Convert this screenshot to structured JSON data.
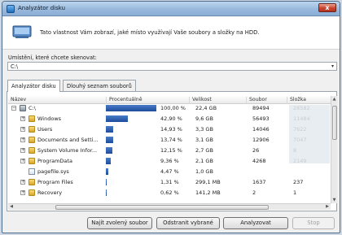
{
  "window": {
    "title": "Analyzátor disku",
    "close_label": "x"
  },
  "info": {
    "description": "Tato vlastnost Vám zobrazí, jaké místo využívají Vaše soubory a složky na HDD."
  },
  "path": {
    "label": "Umístění, které chcete skenovat:",
    "value": "C:\\"
  },
  "tabs": [
    {
      "label": "Analyzátor disku"
    },
    {
      "label": "Dlouhý seznam souborů"
    }
  ],
  "columns": {
    "name": "Název",
    "percent": "Procentuálně",
    "size": "Velikost",
    "files": "Soubor",
    "folders": "Složka"
  },
  "rows": [
    {
      "name": "C:\\",
      "icon": "drive-icon",
      "expander": "−",
      "percent_label": "100,00 %",
      "percent": 100,
      "size": "22,4 GB",
      "files": "89494",
      "folders": "28582"
    },
    {
      "name": "Windows",
      "icon": "folder-icon",
      "expander": "+",
      "percent_label": "42,90 %",
      "percent": 42.9,
      "size": "9,6 GB",
      "files": "56493",
      "folders": "11484"
    },
    {
      "name": "Users",
      "icon": "folder-icon",
      "expander": "+",
      "percent_label": "14,93 %",
      "percent": 14.93,
      "size": "3,3 GB",
      "files": "14046",
      "folders": "7622"
    },
    {
      "name": "Documents and Setti...",
      "icon": "folder-icon",
      "expander": "+",
      "percent_label": "13,74 %",
      "percent": 13.74,
      "size": "3,1 GB",
      "files": "12906",
      "folders": "7047"
    },
    {
      "name": "System Volume Infor...",
      "icon": "folder-icon",
      "expander": "+",
      "percent_label": "12,15 %",
      "percent": 12.15,
      "size": "2,7 GB",
      "files": "26",
      "folders": "8"
    },
    {
      "name": "ProgramData",
      "icon": "folder-icon",
      "expander": "+",
      "percent_label": "9,36 %",
      "percent": 9.36,
      "size": "2,1 GB",
      "files": "4268",
      "folders": "2149"
    },
    {
      "name": "pagefile.sys",
      "icon": "file-icon",
      "expander": "",
      "percent_label": "4,47 %",
      "percent": 4.47,
      "size": "1,0 GB",
      "files": "",
      "folders": ""
    },
    {
      "name": "Program Files",
      "icon": "folder-icon",
      "expander": "+",
      "percent_label": "1,31 %",
      "percent": 1.31,
      "size": "299,1 MB",
      "files": "1637",
      "folders": "237"
    },
    {
      "name": "Recovery",
      "icon": "folder-icon",
      "expander": "+",
      "percent_label": "0,62 %",
      "percent": 0.62,
      "size": "141,2 MB",
      "files": "2",
      "folders": "1"
    }
  ],
  "buttons": {
    "find": "Najít zvolený soubor",
    "remove": "Odstranit vybrané",
    "analyze": "Analyzovat",
    "stop": "Stop"
  }
}
